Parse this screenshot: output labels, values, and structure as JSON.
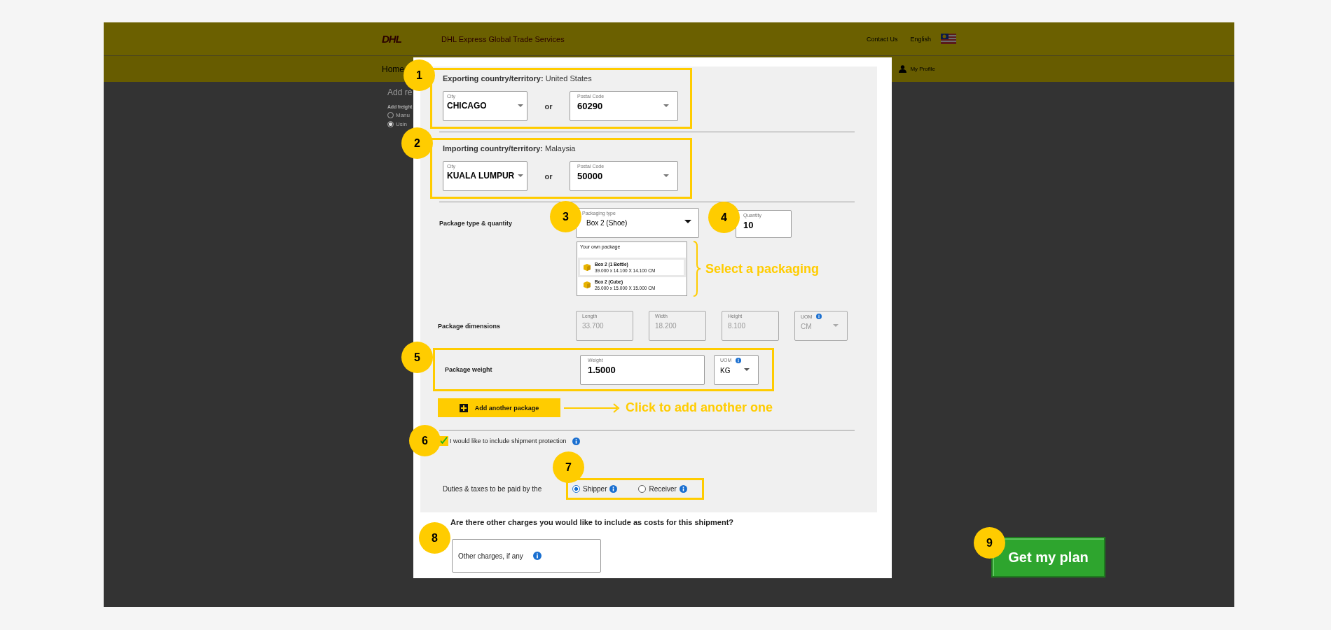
{
  "header": {
    "logo": "DHL",
    "brand": "DHL Express Global Trade Services",
    "links": [
      "Contact Us",
      "English"
    ]
  },
  "nav": {
    "home": "Home",
    "profile": "My Profile"
  },
  "background_form": {
    "title": "Add re",
    "label": "Add freight",
    "options": [
      {
        "label": "Manu",
        "selected": false
      },
      {
        "label": "Usin",
        "selected": true
      }
    ]
  },
  "modal": {
    "locations": [
      {
        "badge": "1",
        "label": "Exporting country/territory:",
        "country": "United States",
        "city_label": "City",
        "city": "CHICAGO",
        "or": "or",
        "postal_label": "Postal Code",
        "postal": "60290"
      },
      {
        "badge": "2",
        "label": "Importing country/territory:",
        "country": "Malaysia",
        "city_label": "City",
        "city": "KUALA LUMPUR",
        "or": "or",
        "postal_label": "Postal Code",
        "postal": "50000"
      }
    ],
    "package": {
      "label": "Package type & quantity",
      "type_badge": "3",
      "type_label": "Packaging type",
      "type": "Box 2 (Shoe)",
      "qty_badge": "4",
      "qty_label": "Quantity",
      "qty": "10",
      "options_header": "Your own package",
      "options": [
        {
          "name": "Box 2 (1 Bottle)",
          "dims": "39.000 x 14.100 X 14.100 CM",
          "selected": true
        },
        {
          "name": "Box 2 (Cube)",
          "dims": "26.000 x 15.000 X 15.000 CM",
          "selected": false
        }
      ],
      "callout": "Select a packaging"
    },
    "dimensions": {
      "label": "Package dimensions",
      "fields": [
        {
          "kind": "text",
          "label": "Length",
          "value": "33.700",
          "disabled": true
        },
        {
          "kind": "text",
          "label": "Width",
          "value": "18.200",
          "disabled": true
        },
        {
          "kind": "text",
          "label": "Height",
          "value": "8.100",
          "disabled": true
        },
        {
          "kind": "select",
          "label": "UOM",
          "value": "CM",
          "disabled": true
        }
      ]
    },
    "weight": {
      "badge": "5",
      "label": "Package weight",
      "weight_label": "Weight",
      "weight": "1.5000",
      "uom_label": "UOM",
      "uom": "KG"
    },
    "add": {
      "label": "Add another package",
      "callout": "Click to add another one"
    },
    "protection": {
      "badge": "6",
      "label": "I would like to include shipment protection",
      "checked": true
    },
    "duties": {
      "badge": "7",
      "label": "Duties & taxes to be paid by the",
      "options": [
        {
          "label": "Shipper",
          "selected": true
        },
        {
          "label": "Receiver",
          "selected": false
        }
      ]
    },
    "other": {
      "question": "Are there other charges you would like to include as costs for this shipment?",
      "badge": "8",
      "placeholder": "Other charges, if any"
    }
  },
  "plan": {
    "badge": "9",
    "label": "Get my plan"
  }
}
